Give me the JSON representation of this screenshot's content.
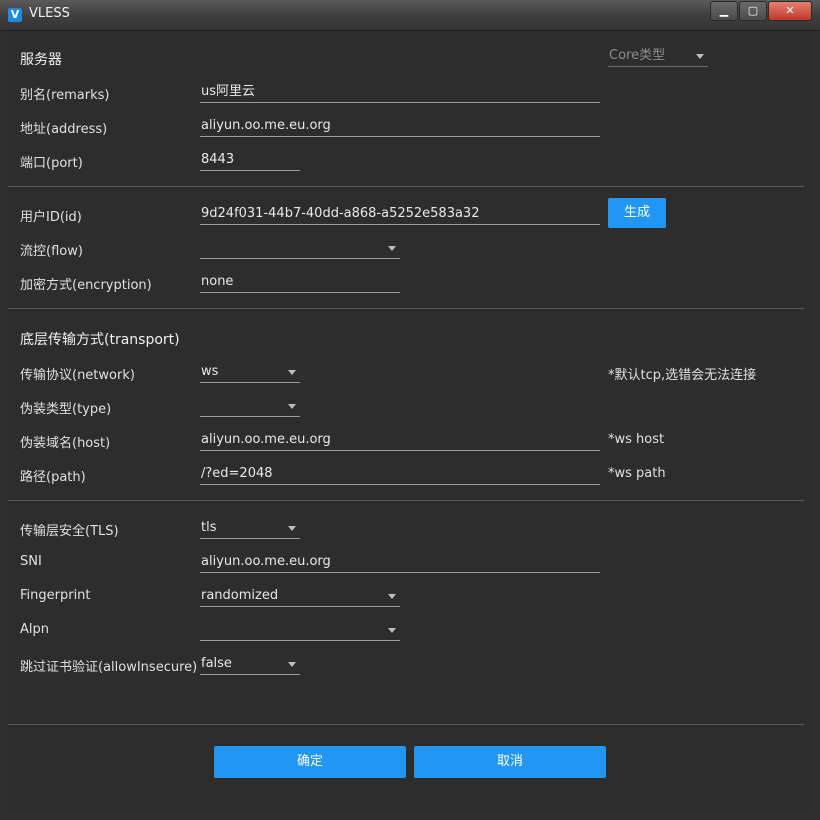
{
  "window": {
    "title": "VLESS",
    "app_icon": "V"
  },
  "core_type": {
    "placeholder": "Core类型"
  },
  "sections": {
    "server": "服务器",
    "transport": "底层传输方式(transport)"
  },
  "fields": {
    "remarks": {
      "label": "别名(remarks)",
      "value": "us阿里云"
    },
    "address": {
      "label": "地址(address)",
      "value": "aliyun.oo.me.eu.org"
    },
    "port": {
      "label": "端口(port)",
      "value": "8443"
    },
    "id": {
      "label": "用户ID(id)",
      "value": "9d24f031-44b7-40dd-a868-a5252e583a32"
    },
    "flow": {
      "label": "流控(flow)",
      "value": ""
    },
    "encryption": {
      "label": "加密方式(encryption)",
      "value": "none"
    },
    "network": {
      "label": "传输协议(network)",
      "value": "ws",
      "hint": "*默认tcp,选错会无法连接"
    },
    "type": {
      "label": "伪装类型(type)",
      "value": ""
    },
    "host": {
      "label": "伪装域名(host)",
      "value": "aliyun.oo.me.eu.org",
      "hint": "*ws host"
    },
    "path": {
      "label": "路径(path)",
      "value": "/?ed=2048",
      "hint": "*ws path"
    },
    "tls": {
      "label": "传输层安全(TLS)",
      "value": "tls"
    },
    "sni": {
      "label": "SNI",
      "value": "aliyun.oo.me.eu.org"
    },
    "fingerprint": {
      "label": "Fingerprint",
      "value": "randomized"
    },
    "alpn": {
      "label": "Alpn",
      "value": ""
    },
    "allow_insecure": {
      "label": "跳过证书验证(allowInsecure)",
      "value": "false"
    }
  },
  "buttons": {
    "generate": "生成",
    "ok": "确定",
    "cancel": "取消"
  },
  "colors": {
    "accent": "#2196f3",
    "background": "#2d2d2d"
  }
}
